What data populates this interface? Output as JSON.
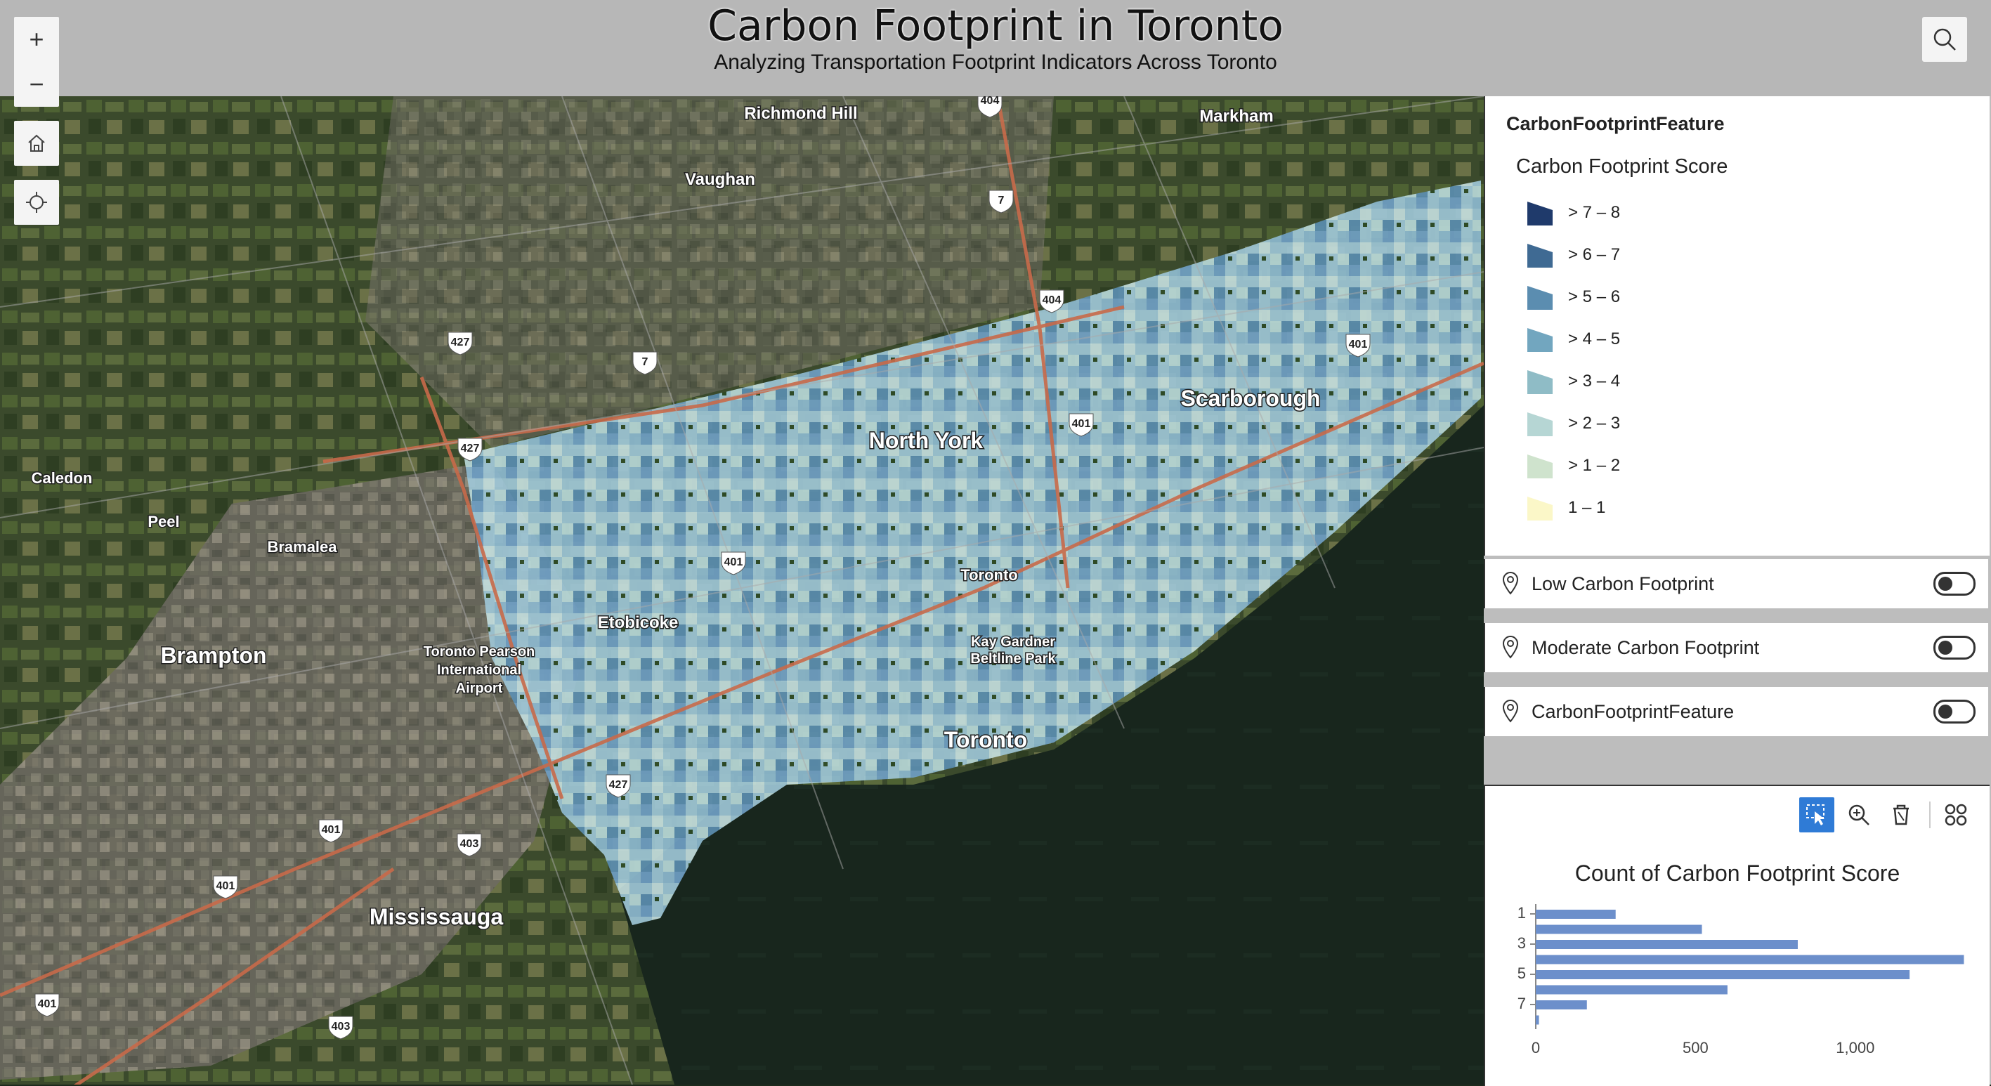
{
  "header": {
    "title": "Carbon Footprint in Toronto",
    "subtitle": "Analyzing Transportation Footprint Indicators Across Toronto"
  },
  "map_controls": {
    "zoom_in": "+",
    "zoom_out": "−"
  },
  "map_labels": {
    "richmond_hill": "Richmond Hill",
    "markham": "Markham",
    "vaughan": "Vaughan",
    "scarborough": "Scarborough",
    "north_york": "North York",
    "caledon": "Caledon",
    "peel": "Peel",
    "bramalea": "Bramalea",
    "toronto_mid": "Toronto",
    "etobicoke": "Etobicoke",
    "kay_gardner_1": "Kay Gardner",
    "kay_gardner_2": "Beltline Park",
    "brampton": "Brampton",
    "airport_1": "Toronto Pearson",
    "airport_2": "International",
    "airport_3": "Airport",
    "toronto_main": "Toronto",
    "mississauga": "Mississauga"
  },
  "highway_shields": {
    "h404_top": "404",
    "h7_a": "7",
    "h404_b": "404",
    "h427_a": "427",
    "h7_b": "7",
    "h401_a": "401",
    "h427_b": "427",
    "h401_b": "401",
    "h401_c": "401",
    "h427_c": "427",
    "h401_d": "401",
    "h403_a": "403",
    "h401_e": "401",
    "h401_f": "401",
    "h403_b": "403"
  },
  "legend": {
    "layer_title": "CarbonFootprintFeature",
    "field_title": "Carbon Footprint Score",
    "classes": [
      {
        "label": "> 7 – 8",
        "color": "#1f3a6b"
      },
      {
        "label": "> 6 – 7",
        "color": "#3f6a93"
      },
      {
        "label": "> 5 – 6",
        "color": "#5b8db0"
      },
      {
        "label": "> 4 – 5",
        "color": "#72a6bf"
      },
      {
        "label": "> 3 – 4",
        "color": "#8fbcc6"
      },
      {
        "label": "> 2 – 3",
        "color": "#b6d6d4"
      },
      {
        "label": "> 1 – 2",
        "color": "#cfe3cd"
      },
      {
        "label": "1 – 1",
        "color": "#fbf7c8"
      }
    ]
  },
  "layers": [
    {
      "name": "Low Carbon Footprint",
      "on": false
    },
    {
      "name": "Moderate Carbon Footprint",
      "on": false
    },
    {
      "name": "CarbonFootprintFeature",
      "on": false
    }
  ],
  "chart_panel": {
    "tools": [
      "selection-icon",
      "zoom-to-icon",
      "clear-selection-icon",
      "grid-menu-icon"
    ]
  },
  "chart_data": {
    "type": "bar",
    "orientation": "horizontal",
    "title": "Count of Carbon Footprint Score",
    "categories": [
      "1",
      "2",
      "3",
      "4",
      "5",
      "6",
      "7",
      "8"
    ],
    "tick_labels_y": [
      "1",
      "3",
      "5",
      "7"
    ],
    "values": [
      250,
      520,
      820,
      1340,
      1170,
      600,
      160,
      10
    ],
    "xlim": [
      0,
      1350
    ],
    "xticks": [
      0,
      500,
      1000
    ],
    "xtick_labels": [
      "0",
      "500",
      "1,000"
    ],
    "color": "#6c8fcb"
  },
  "colors": {
    "header_bg": "#b7b7b7",
    "accent_blue": "#2f7bd6"
  }
}
